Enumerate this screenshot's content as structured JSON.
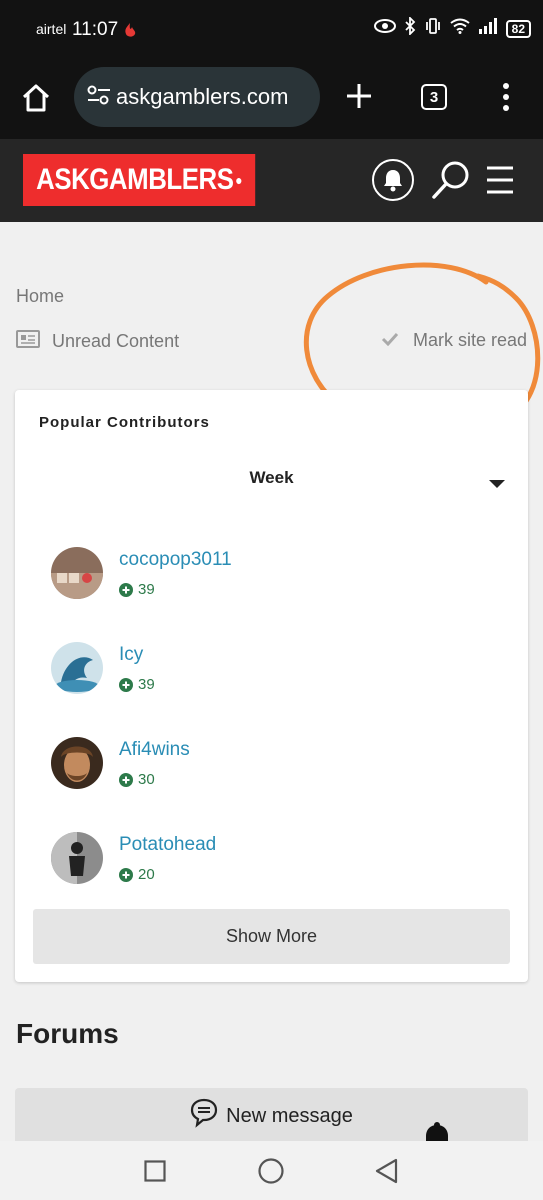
{
  "status_bar": {
    "carrier": "airtel",
    "time": "11:07",
    "battery": "82"
  },
  "browser": {
    "url": "askgamblers.com",
    "tab_count": "3"
  },
  "site": {
    "logo_text": "ASKGAMBLERS",
    "brand_color": "#ee2d2d"
  },
  "breadcrumb": {
    "home": "Home"
  },
  "actions": {
    "unread": "Unread Content",
    "mark_read": "Mark site read"
  },
  "popular_contributors": {
    "title": "Popular Contributors",
    "period": "Week",
    "contributors": [
      {
        "name": "cocopop3011",
        "rep": "39"
      },
      {
        "name": "Icy",
        "rep": "39"
      },
      {
        "name": "Afi4wins",
        "rep": "30"
      },
      {
        "name": "Potatohead",
        "rep": "20"
      }
    ],
    "show_more": "Show More"
  },
  "forums": {
    "title": "Forums",
    "new_message": "New message"
  },
  "colors": {
    "link": "#2a8db5",
    "reputation": "#2d7a4a",
    "annotation": "#f08a3a"
  }
}
